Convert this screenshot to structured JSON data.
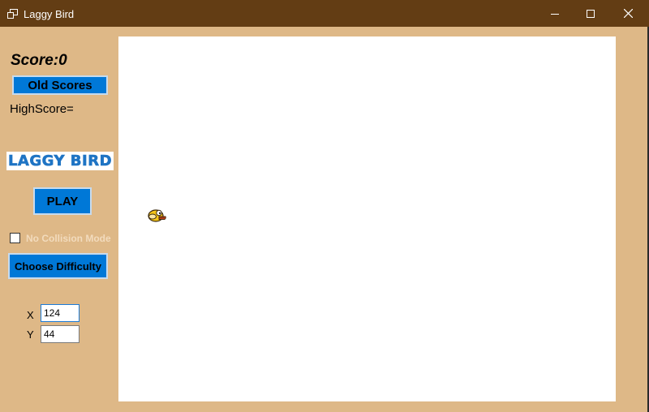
{
  "window": {
    "title": "Laggy Bird",
    "controls": {
      "minimize": "minimize-icon",
      "maximize": "maximize-icon",
      "close": "close-icon"
    }
  },
  "sidebar": {
    "score_text": "Score:0",
    "old_scores_label": "Old Scores",
    "highscore_text": "HighScore=",
    "logo_text": "LAGGY BIRD",
    "play_label": "PLAY",
    "no_collision": {
      "label": "No Collision Mode",
      "checked": false
    },
    "difficulty_label": "Choose Difficulty",
    "x": {
      "label": "X",
      "value": "124"
    },
    "y": {
      "label": "Y",
      "value": "44"
    }
  },
  "game": {
    "bird_icon": "flappy-bird-icon"
  },
  "colors": {
    "titlebar": "#633d14",
    "window_bg": "#deb887",
    "button_blue": "#0078d7",
    "logo_blue": "#1f74c4",
    "canvas": "#ffffff"
  }
}
